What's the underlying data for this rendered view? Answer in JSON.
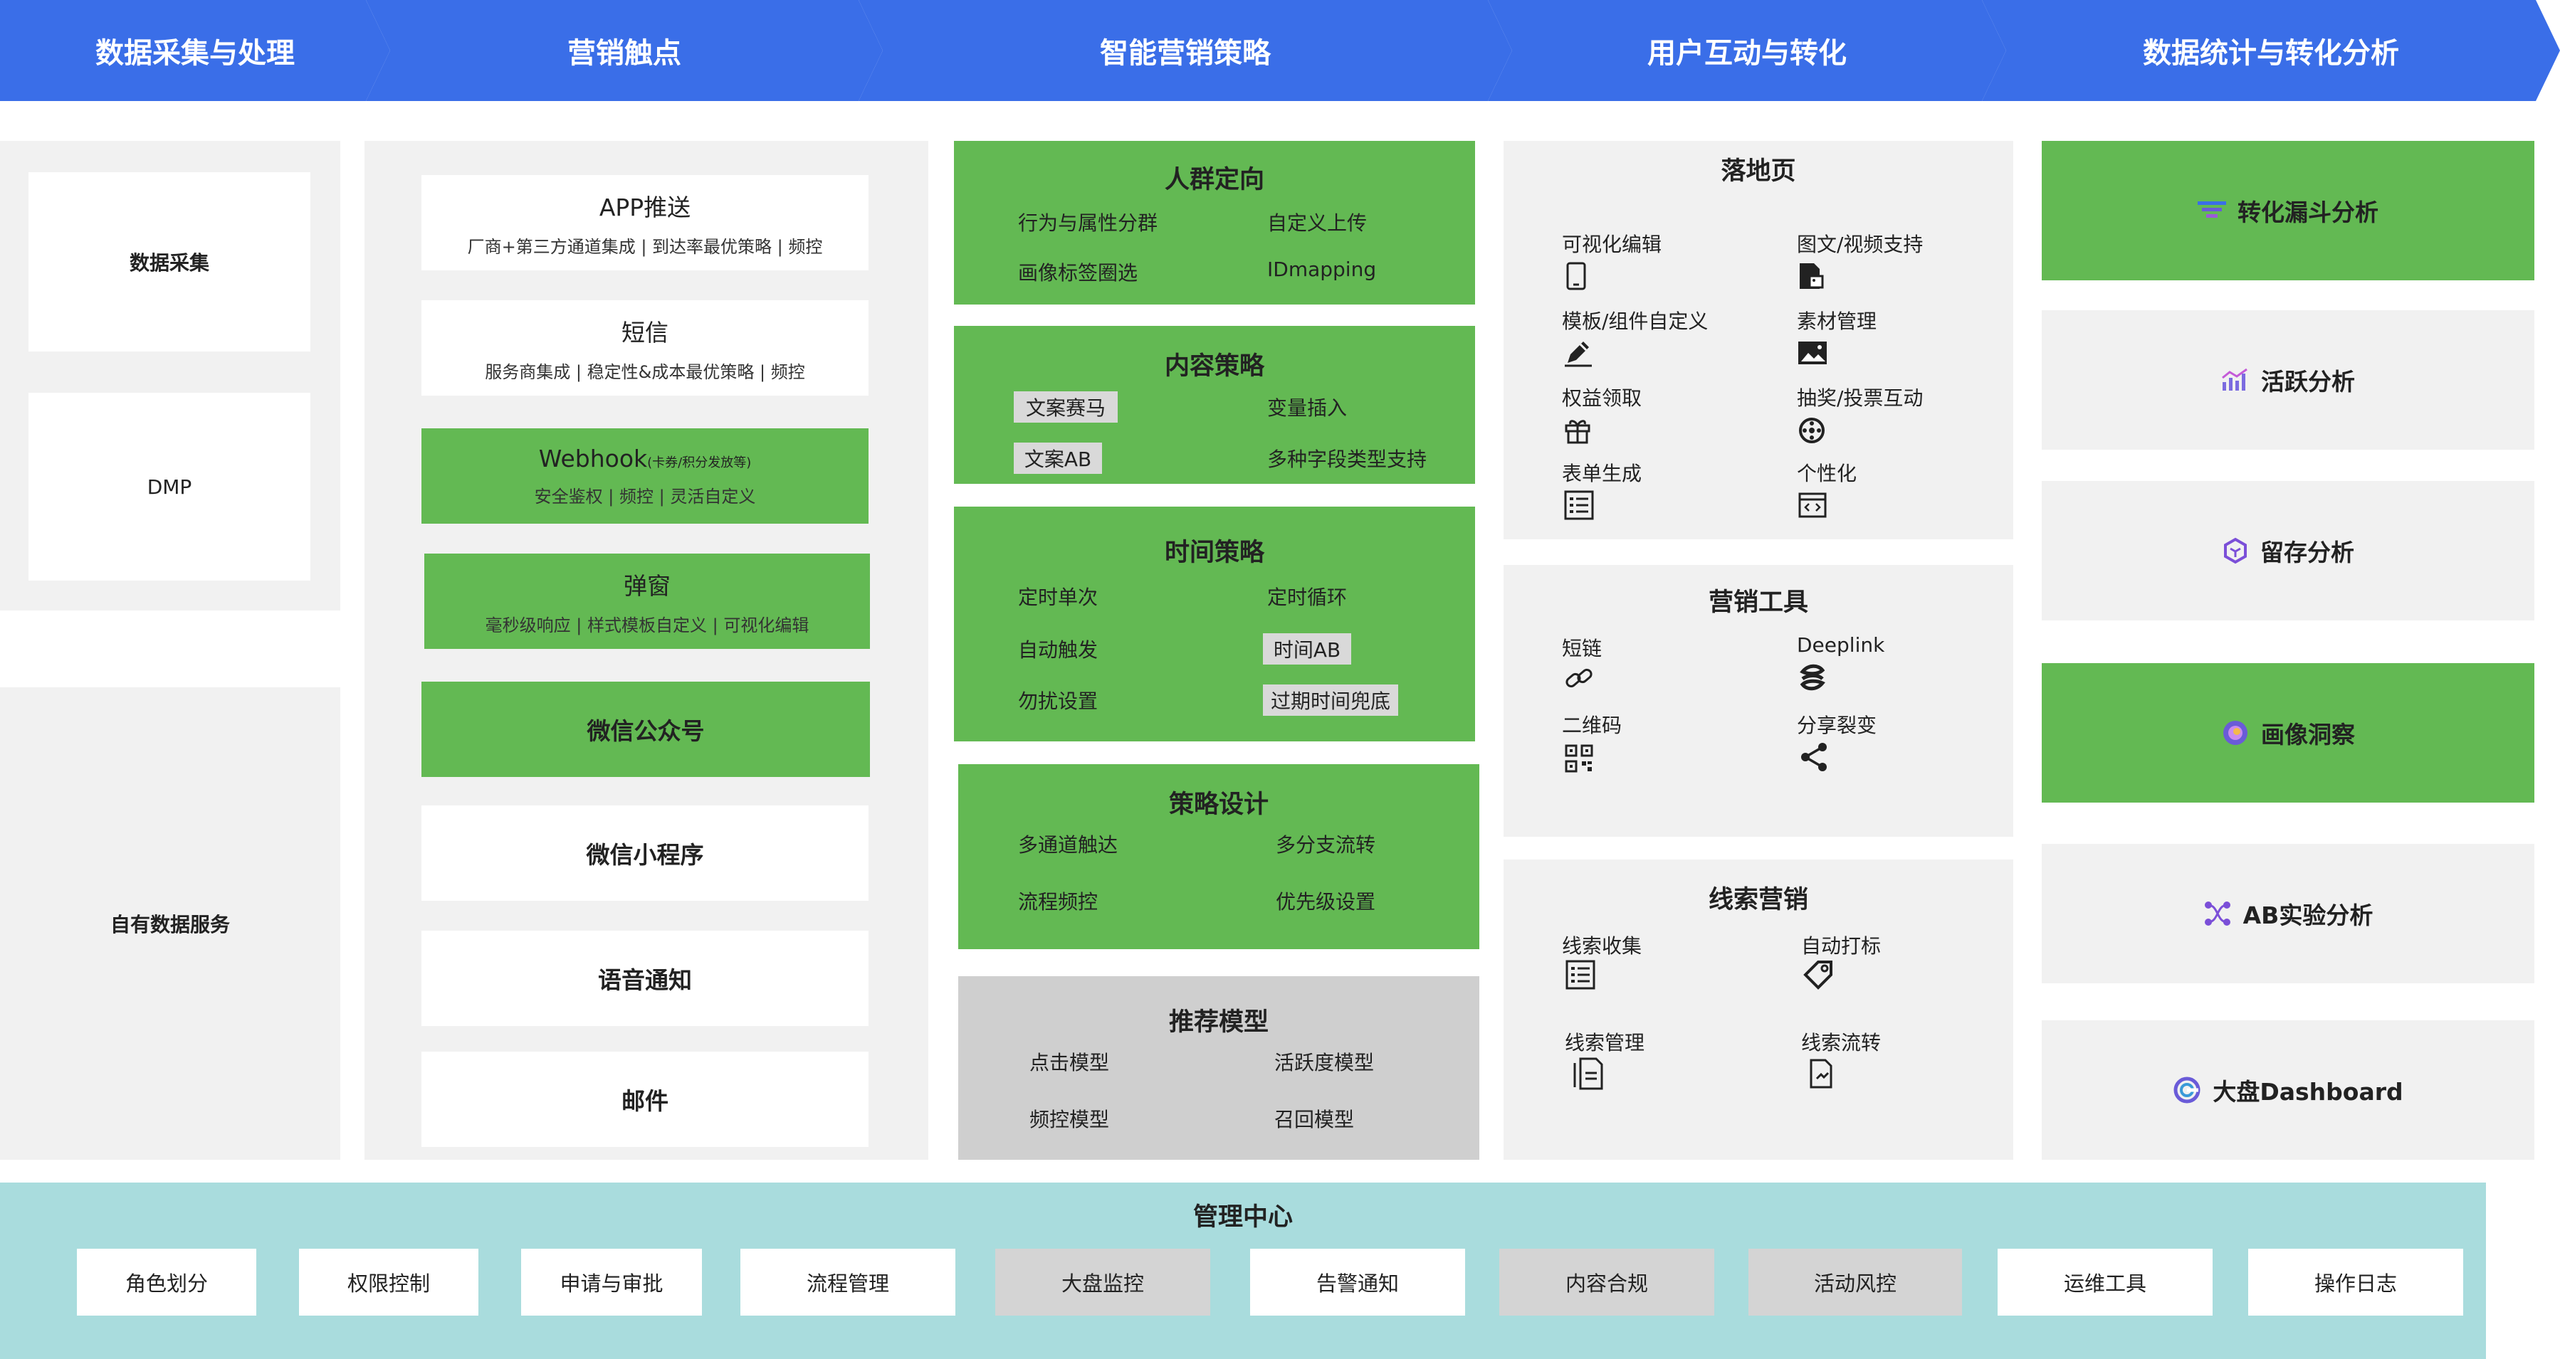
{
  "header": {
    "stages": [
      "数据采集与处理",
      "营销触点",
      "智能营销策略",
      "用户互动与转化",
      "数据统计与转化分析"
    ],
    "color": "#3a6ee8"
  },
  "colors": {
    "green": "#63b953",
    "gray": "#f1f1f1",
    "teal": "#a9dcdd",
    "dark_gray": "#cfcfcf"
  },
  "data_col": {
    "items": [
      "数据采集",
      "DMP",
      "自有数据服务"
    ]
  },
  "touch_col": {
    "app": {
      "title": "APP推送",
      "desc": "厂商+第三方通道集成 | 到达率最优策略 | 频控"
    },
    "sms": {
      "title": "短信",
      "desc": "服务商集成 | 稳定性&成本最优策略 | 频控"
    },
    "webhook": {
      "title": "Webhook",
      "title_note": "(卡券/积分发放等)",
      "desc": "安全鉴权 | 频控 |  灵活自定义"
    },
    "popup": {
      "title": "弹窗",
      "desc": "毫秒级响应 | 样式模板自定义 |  可视化编辑"
    },
    "wechat_oa": "微信公众号",
    "wechat_mp": "微信小程序",
    "voice": "语音通知",
    "email": "邮件"
  },
  "strategy_col": {
    "crowd": {
      "title": "人群定向",
      "items": [
        "行为与属性分群",
        "自定义上传",
        "画像标签圈选",
        "IDmapping"
      ]
    },
    "content": {
      "title": "内容策略",
      "items": [
        "文案赛马",
        "变量插入",
        "文案AB",
        "多种字段类型支持"
      ]
    },
    "time": {
      "title": "时间策略",
      "items": [
        "定时单次",
        "定时循环",
        "自动触发",
        "时间AB",
        "勿扰设置",
        "过期时间兜底"
      ]
    },
    "design": {
      "title": "策略设计",
      "items": [
        "多通道触达",
        "多分支流转",
        "流程频控",
        "优先级设置"
      ]
    },
    "model": {
      "title": "推荐模型",
      "items": [
        "点击模型",
        "活跃度模型",
        "频控模型",
        "召回模型"
      ]
    }
  },
  "interact_col": {
    "landing": {
      "title": "落地页",
      "items": [
        "可视化编辑",
        "图文/视频支持",
        "模板/组件自定义",
        "素材管理",
        "权益领取",
        "抽奖/投票互动",
        "表单生成",
        "个性化"
      ]
    },
    "tools": {
      "title": "营销工具",
      "items": [
        "短链",
        "Deeplink",
        "二维码",
        "分享裂变"
      ]
    },
    "leads": {
      "title": "线索营销",
      "items": [
        "线索收集",
        "自动打标",
        "线索管理",
        "线索流转"
      ]
    }
  },
  "stats_col": {
    "items": [
      "转化漏斗分析",
      "活跃分析",
      "留存分析",
      "画像洞察",
      "AB实验分析",
      "大盘Dashboard"
    ]
  },
  "management": {
    "title": "管理中心",
    "items": [
      "角色划分",
      "权限控制",
      "申请与审批",
      "流程管理",
      "大盘监控",
      "告警通知",
      "内容合规",
      "活动风控",
      "运维工具",
      "操作日志"
    ]
  }
}
